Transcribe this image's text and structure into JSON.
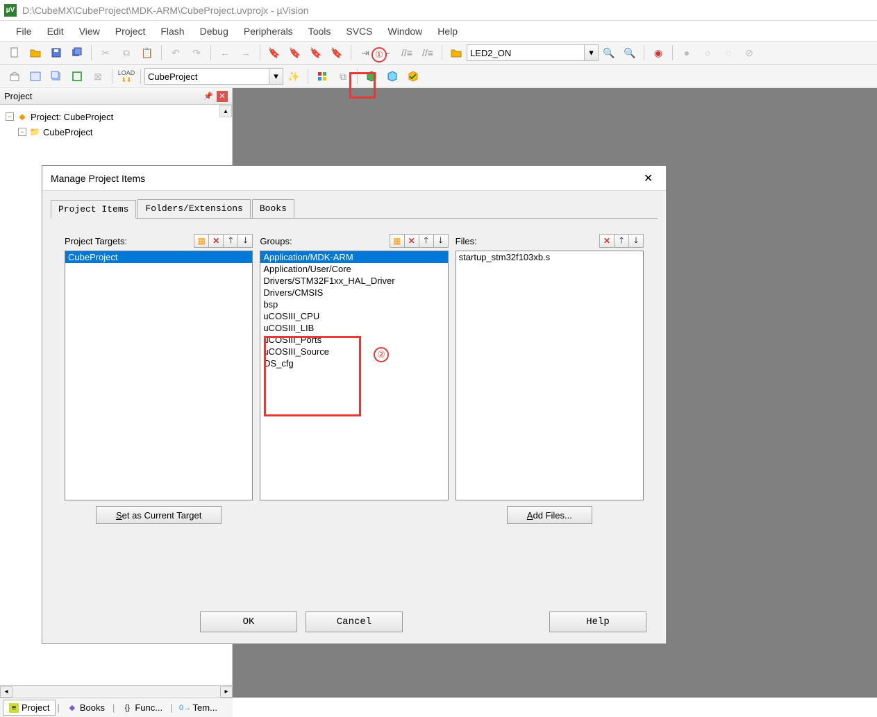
{
  "window": {
    "title": "D:\\CubeMX\\CubeProject\\MDK-ARM\\CubeProject.uvprojx - µVision"
  },
  "menu": [
    "File",
    "Edit",
    "View",
    "Project",
    "Flash",
    "Debug",
    "Peripherals",
    "Tools",
    "SVCS",
    "Window",
    "Help"
  ],
  "toolbar1": {
    "combo_value": "LED2_ON"
  },
  "toolbar2": {
    "target_name": "CubeProject"
  },
  "callouts": {
    "one": "①",
    "two": "②"
  },
  "project_panel": {
    "title": "Project",
    "nodes": [
      {
        "indent": 0,
        "expand": "−",
        "icon": "diamond",
        "label": "Project: CubeProject"
      },
      {
        "indent": 1,
        "expand": "−",
        "icon": "folder",
        "label": "CubeProject"
      }
    ],
    "truncated_row": "…"
  },
  "dialog": {
    "title": "Manage Project Items",
    "tabs": [
      "Project Items",
      "Folders/Extensions",
      "Books"
    ],
    "active_tab": 0,
    "targets": {
      "label": "Project Targets:",
      "items": [
        "CubeProject"
      ],
      "selected": 0,
      "button": "Set as Current Target",
      "button_u": "S"
    },
    "groups": {
      "label": "Groups:",
      "items": [
        "Application/MDK-ARM",
        "Application/User/Core",
        "Drivers/STM32F1xx_HAL_Driver",
        "Drivers/CMSIS",
        "bsp",
        "uCOSIII_CPU",
        "uCOSIII_LIB",
        "uCOSIII_Ports",
        "uCOSIII_Source",
        "OS_cfg"
      ],
      "selected": 0
    },
    "files": {
      "label": "Files:",
      "items": [
        "startup_stm32f103xb.s"
      ],
      "button": "Add Files...",
      "button_u": "A"
    },
    "buttons": {
      "ok": "OK",
      "cancel": "Cancel",
      "help": "Help"
    }
  },
  "bottom_tabs": [
    {
      "icon": "≡",
      "label": "Project",
      "active": true
    },
    {
      "icon": "◆",
      "label": "Books"
    },
    {
      "icon": "{}",
      "label": "Func..."
    },
    {
      "icon": "0→",
      "label": "Tem..."
    }
  ]
}
